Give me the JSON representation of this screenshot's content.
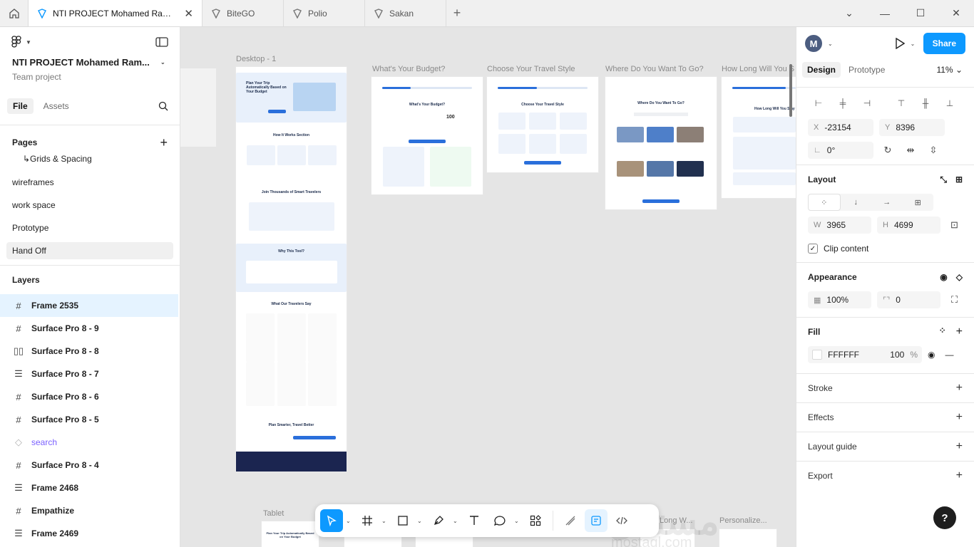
{
  "tabs": [
    {
      "label": "NTI PROJECT Mohamed Ramadan",
      "active": true
    },
    {
      "label": "BiteGO",
      "active": false
    },
    {
      "label": "Polio",
      "active": false
    },
    {
      "label": "Sakan",
      "active": false
    }
  ],
  "left": {
    "project_title": "NTI PROJECT Mohamed Ram...",
    "project_sub": "Team project",
    "file_tab": "File",
    "assets_tab": "Assets",
    "pages_title": "Pages",
    "pages": [
      "↳Grids & Spacing",
      "wireframes",
      "work space",
      "Prototype",
      "Hand Off"
    ],
    "layers_title": "Layers",
    "layers": [
      {
        "name": "Frame 2535",
        "icon": "frame-icon"
      },
      {
        "name": "Surface Pro 8 - 9",
        "icon": "frame-icon"
      },
      {
        "name": "Surface Pro 8 - 8",
        "icon": "columns-layout-icon"
      },
      {
        "name": "Surface Pro 8 - 7",
        "icon": "rows-layout-icon"
      },
      {
        "name": "Surface Pro 8 - 6",
        "icon": "frame-icon"
      },
      {
        "name": "Surface Pro 8 - 5",
        "icon": "frame-icon"
      },
      {
        "name": "search",
        "icon": "component-icon"
      },
      {
        "name": "Surface Pro 8 - 4",
        "icon": "frame-icon"
      },
      {
        "name": "Frame 2468",
        "icon": "rows-layout-icon"
      },
      {
        "name": "Empathize",
        "icon": "frame-icon"
      },
      {
        "name": "Frame 2469",
        "icon": "rows-layout-icon"
      }
    ]
  },
  "canvas": {
    "desktop_label": "Desktop - 1",
    "frame_labels": [
      "What's Your Budget?",
      "Choose Your Travel Style",
      "Where Do You Want To Go?",
      "How Long Will You S"
    ],
    "tablet_label": "Tablet",
    "bottom_labels": [
      "Long W...",
      "Personalize..."
    ],
    "mini": {
      "hero": "Plan Your Trip Automatically Based on Your Budget",
      "how": "How It Works Section",
      "join": "Join Thousands of Smart Travelers",
      "why": "Why This Tool?",
      "say": "What Our Travelers Say",
      "plan": "Plan Smarter, Travel Better",
      "budget": "What's Your Budget?",
      "budget_val": "100",
      "style": "Choose Your Travel Style",
      "where": "Where Do You Want To Go?",
      "howlong": "How Long Will You Stay",
      "tablet_hero": "Plan Your Trip Automatically Based on Your Budget"
    },
    "watermark": "مستقل",
    "watermark_sub": "mostaql.com"
  },
  "right": {
    "avatar": "M",
    "share": "Share",
    "design_tab": "Design",
    "prototype_tab": "Prototype",
    "zoom": "11%",
    "x": "-23154",
    "y": "8396",
    "rotation": "0°",
    "layout_title": "Layout",
    "w": "3965",
    "h": "4699",
    "clip": "Clip content",
    "appearance_title": "Appearance",
    "opacity": "100%",
    "radius": "0",
    "fill_title": "Fill",
    "fill_hex": "FFFFFF",
    "fill_opacity": "100",
    "fill_pct": "%",
    "stroke": "Stroke",
    "effects": "Effects",
    "layout_guide": "Layout guide",
    "export": "Export",
    "help": "?"
  }
}
